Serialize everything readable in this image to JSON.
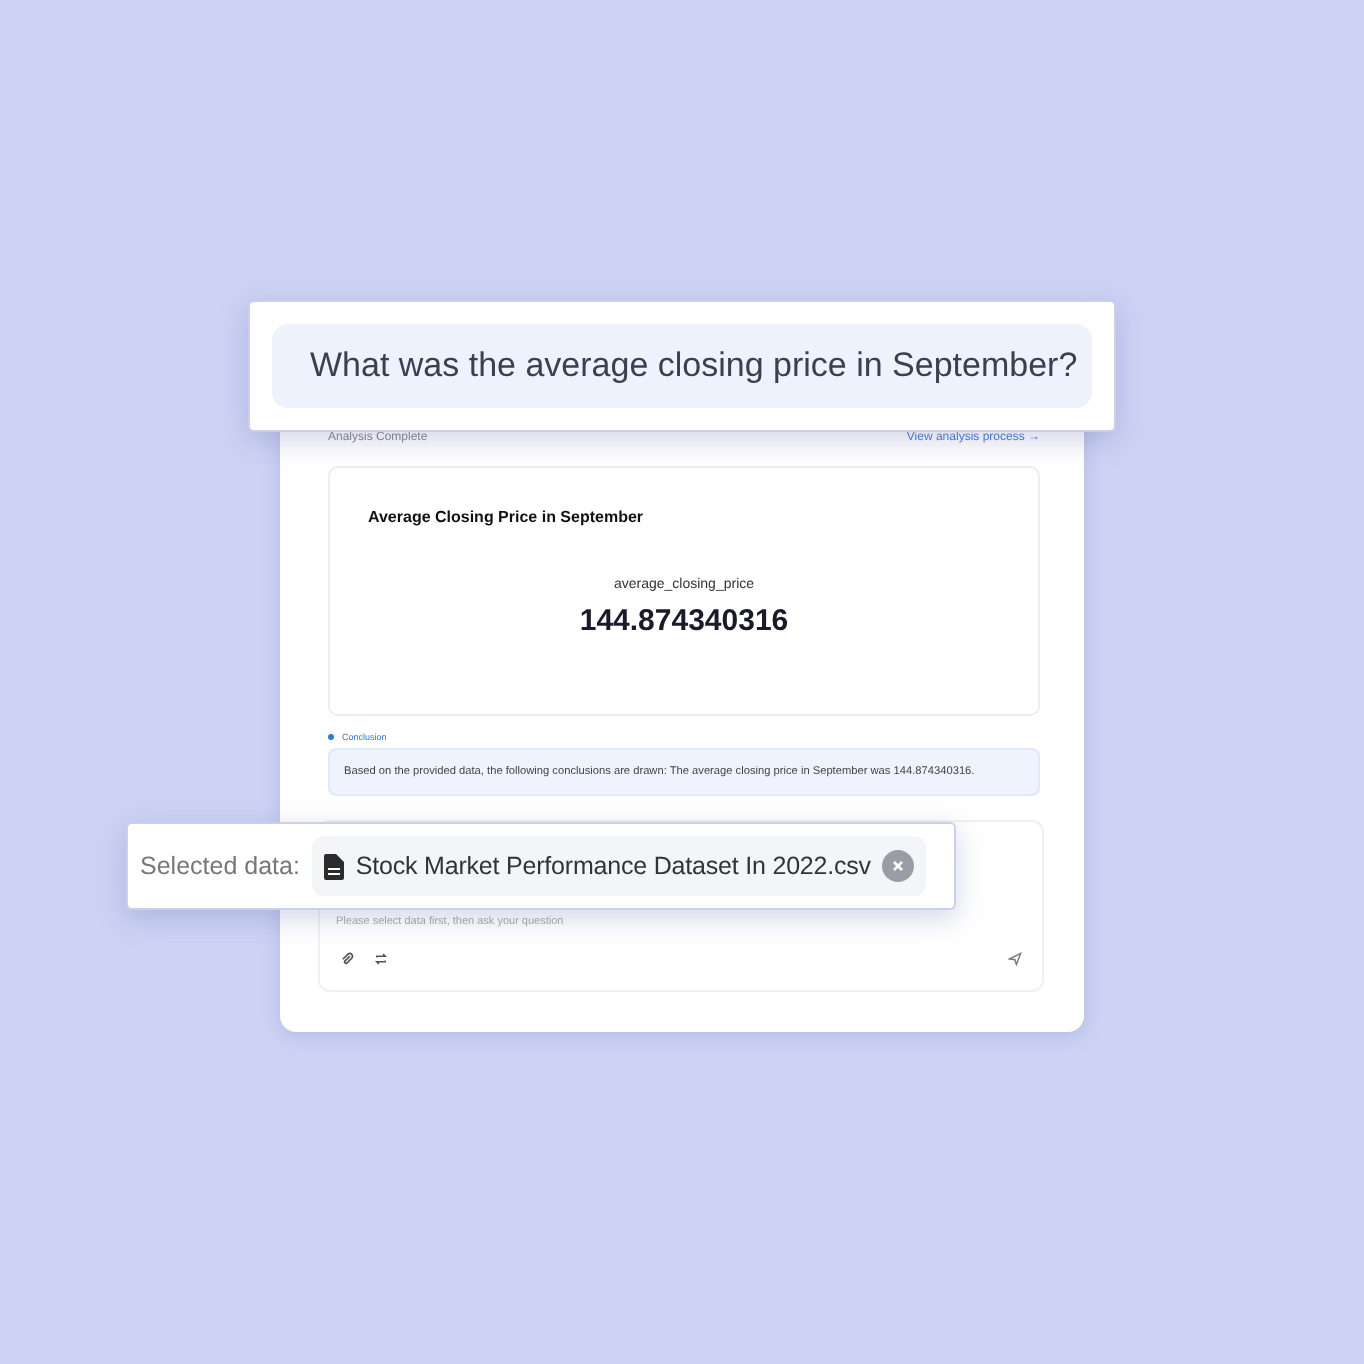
{
  "question": {
    "text": "What was the average closing price in September?"
  },
  "analysis": {
    "status": "Analysis Complete",
    "link": "View analysis process →"
  },
  "result": {
    "title": "Average Closing Price in September",
    "metric_label": "average_closing_price",
    "metric_value": "144.874340316"
  },
  "conclusion": {
    "label": "Conclusion",
    "text": "Based on the provided data, the following conclusions are drawn: The average closing price in September was 144.874340316."
  },
  "selected_data": {
    "label": "Selected data:",
    "file": "Stock Market Performance Dataset In 2022.csv"
  },
  "input": {
    "placeholder": "Please select data first, then ask your question"
  }
}
